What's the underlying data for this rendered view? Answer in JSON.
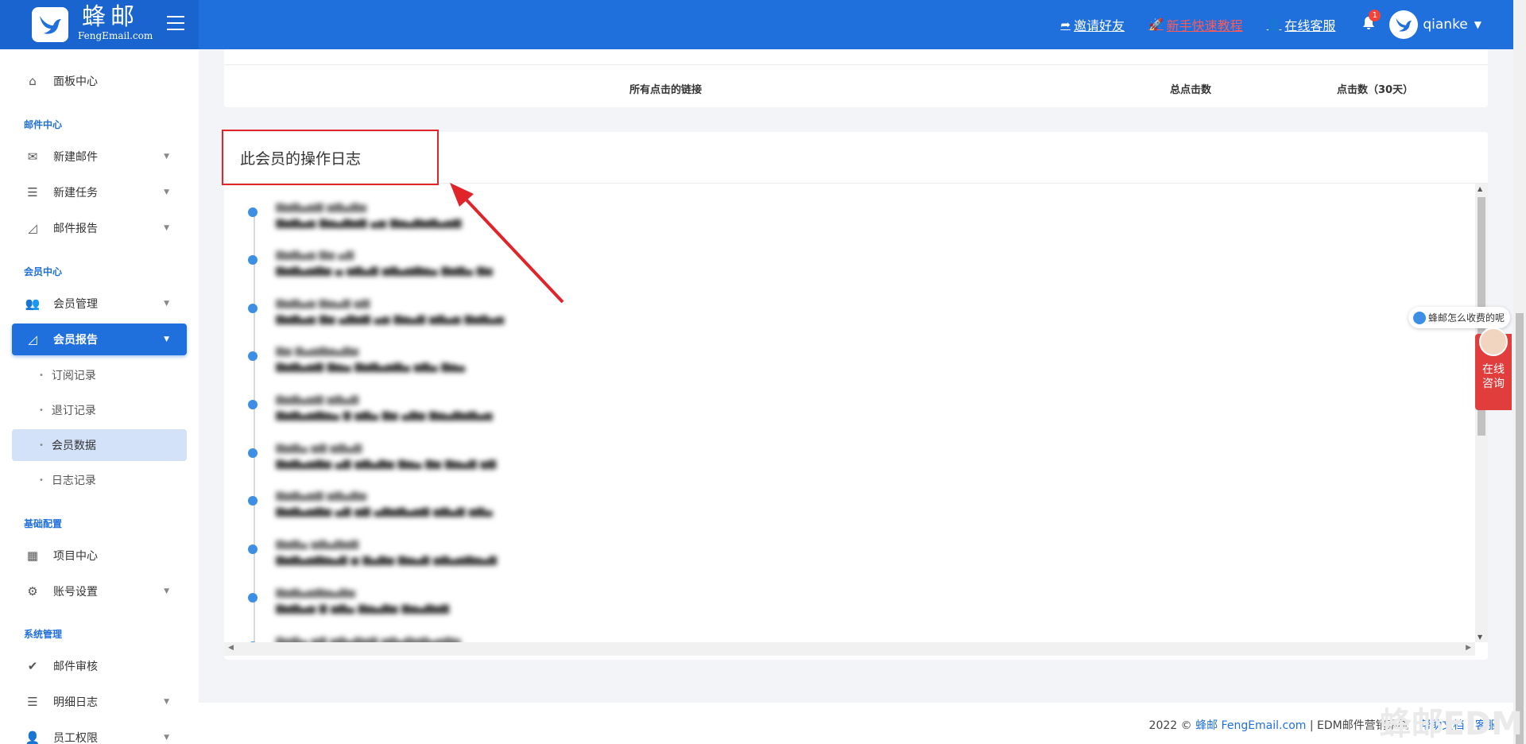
{
  "header": {
    "brand_name": "蜂邮",
    "brand_sub": "FengEmail.com",
    "invite": "邀请好友",
    "tutorial": "新手快速教程",
    "service": "在线客服",
    "notif_count": "1",
    "username": "qianke"
  },
  "sidebar": {
    "dashboard": "面板中心",
    "section_mail": "邮件中心",
    "new_mail": "新建邮件",
    "new_task": "新建任务",
    "mail_report": "邮件报告",
    "section_member": "会员中心",
    "member_manage": "会员管理",
    "member_report": "会员报告",
    "sub_subscribe": "订阅记录",
    "sub_unsubscribe": "退订记录",
    "sub_member_data": "会员数据",
    "sub_log": "日志记录",
    "section_base": "基础配置",
    "project_center": "项目中心",
    "account_settings": "账号设置",
    "section_system": "系统管理",
    "mail_audit": "邮件审核",
    "detail_log": "明细日志",
    "staff_perm": "员工权限"
  },
  "clicks_table": {
    "col_links": "所有点击的链接",
    "col_total": "总点击数",
    "col_30days": "点击数（30天）"
  },
  "log_panel": {
    "title": "此会员的操作日志"
  },
  "chat": {
    "pill_text": "蜂邮怎么收费的呢",
    "consult_line1": "在线",
    "consult_line2": "咨询"
  },
  "footer": {
    "year": "2022 ©",
    "brand_link": "蜂邮 FengEmail.com",
    "system": "EDM邮件营销系统",
    "help": "帮助文档",
    "service": "客服",
    "watermark": "蜂邮EDM"
  },
  "colors": {
    "primary": "#1f6fdd",
    "accent_red": "#e0242a",
    "timeline_dot": "#3d8fe6"
  }
}
